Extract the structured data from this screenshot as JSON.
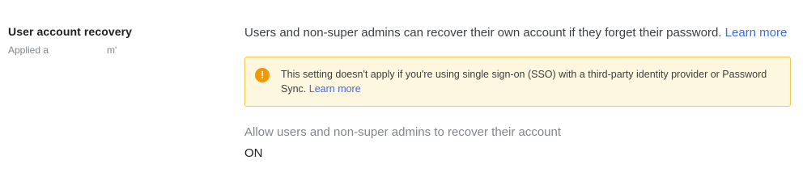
{
  "setting": {
    "title": "User account recovery",
    "applied_prefix": "Applied a",
    "applied_suffix": "m'"
  },
  "description": {
    "text": "Users and non-super admins can recover their own account if they forget their password. ",
    "link_label": "Learn more"
  },
  "notice": {
    "icon": "exclamation-icon",
    "icon_glyph": "!",
    "icon_color": "#f29900",
    "background_color": "#fef7e0",
    "border_color": "#f2c94c",
    "text": "This setting doesn't apply if you're using single sign-on (SSO) with a third-party identity provider or Password Sync. ",
    "link_label": "Learn more"
  },
  "toggle": {
    "label": "Allow users and non-super admins to recover their account",
    "value": "ON"
  },
  "colors": {
    "link": "#3f6bd6",
    "secondary_text": "#80868b"
  }
}
